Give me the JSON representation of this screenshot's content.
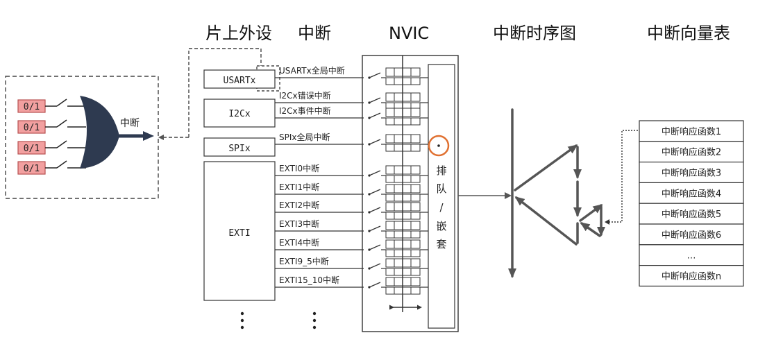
{
  "headers": {
    "peripherals": "片上外设",
    "interrupt": "中断",
    "nvic": "NVIC",
    "timing": "中断时序图",
    "vector_table": "中断向量表"
  },
  "gate": {
    "inputs": [
      "0/1",
      "0/1",
      "0/1",
      "0/1"
    ],
    "output_label": "中断"
  },
  "peripherals": [
    "USARTx",
    "I2Cx",
    "SPIx",
    "EXTI"
  ],
  "interrupt_lines": [
    "USARTx全局中断",
    "I2Cx错误中断",
    "I2Cx事件中断",
    "SPIx全局中断",
    "EXTI0中断",
    "EXTI1中断",
    "EXTI2中断",
    "EXTI3中断",
    "EXTI4中断",
    "EXTI9_5中断",
    "EXTI15_10中断"
  ],
  "nvic": {
    "queue_chars": [
      "排",
      "队",
      "/",
      "嵌",
      "套"
    ]
  },
  "vector_table": [
    "中断响应函数1",
    "中断响应函数2",
    "中断响应函数3",
    "中断响应函数4",
    "中断响应函数5",
    "中断响应函数6",
    "…",
    "中断响应函数n"
  ],
  "colors": {
    "input_fill": "#f2a0a0",
    "input_stroke": "#b85050",
    "gate": "#2e3a50",
    "highlight_circle": "#e07030",
    "arrow": "#555555"
  }
}
